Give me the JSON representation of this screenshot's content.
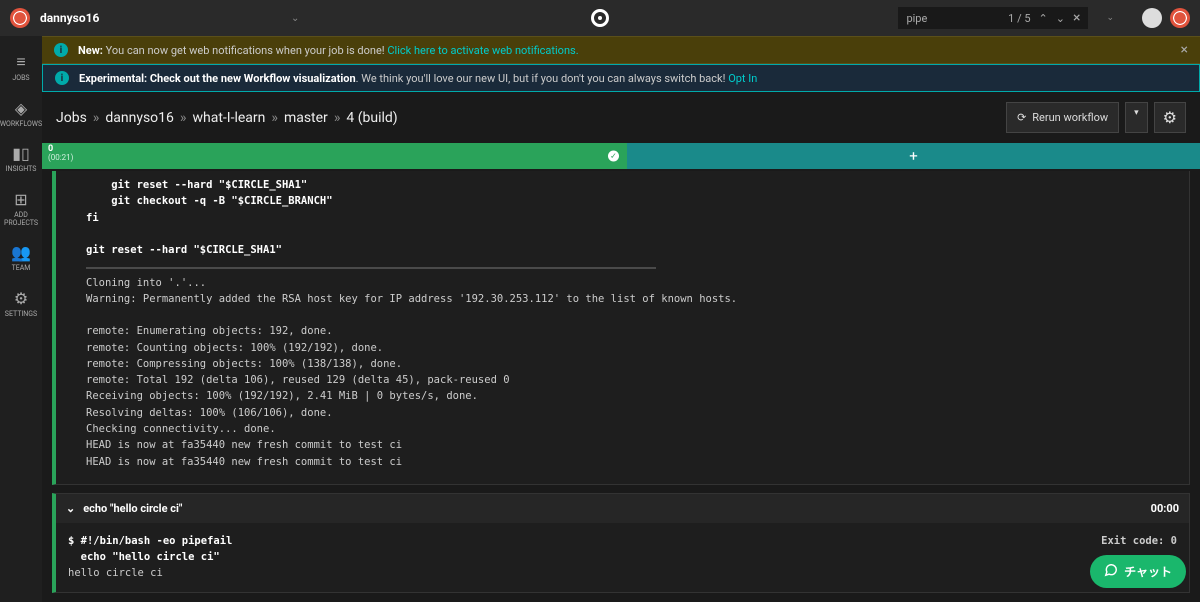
{
  "topbar": {
    "username": "dannyso16",
    "search_value": "pipe",
    "search_count": "1 / 5"
  },
  "sidebar": {
    "items": [
      {
        "icon": "≡",
        "label": "JOBS"
      },
      {
        "icon": "⬡",
        "label": "WORKFLOWS"
      },
      {
        "icon": "▮▮",
        "label": "INSIGHTS"
      },
      {
        "icon": "⊕",
        "label": "ADD PROJECTS"
      },
      {
        "icon": "👥",
        "label": "TEAM"
      },
      {
        "icon": "⚙",
        "label": "SETTINGS"
      }
    ]
  },
  "banner_yellow": {
    "bold": "New:",
    "text": " You can now get web notifications when your job is done! ",
    "link": "Click here to activate web notifications."
  },
  "banner_blue": {
    "bold": "Experimental: Check out the new Workflow visualization",
    "text": ". We think you'll love our new UI, but if you don't you can always switch back! ",
    "link": "Opt In"
  },
  "breadcrumb": {
    "items": [
      "Jobs",
      "dannyso16",
      "what-I-learn",
      "master",
      "4 (build)"
    ],
    "rerun": "Rerun workflow"
  },
  "tabs": {
    "green_label": "0",
    "green_time": "(00:21)"
  },
  "step1": {
    "body": "    git reset --hard \"$CIRCLE_SHA1\"\n    git checkout -q -B \"$CIRCLE_BRANCH\"\nfi\n\ngit reset --hard \"$CIRCLE_SHA1\"",
    "output": "Cloning into '.'...\nWarning: Permanently added the RSA host key for IP address '192.30.253.112' to the list of known hosts.\n\nremote: Enumerating objects: 192, done.\nremote: Counting objects: 100% (192/192), done.\nremote: Compressing objects: 100% (138/138), done.\nremote: Total 192 (delta 106), reused 129 (delta 45), pack-reused 0\nReceiving objects: 100% (192/192), 2.41 MiB | 0 bytes/s, done.\nResolving deltas: 100% (106/106), done.\nChecking connectivity... done.\nHEAD is now at fa35440 new fresh commit to test ci\nHEAD is now at fa35440 new fresh commit to test ci"
  },
  "step2": {
    "title": "echo \"hello circle ci\"",
    "time": "00:00",
    "body_bold": "$ #!/bin/bash -eo pipefail\n  echo \"hello circle ci\"",
    "body_out": "\nhello circle ci",
    "exit": "Exit code: 0"
  },
  "chat": {
    "label": "チャット"
  }
}
